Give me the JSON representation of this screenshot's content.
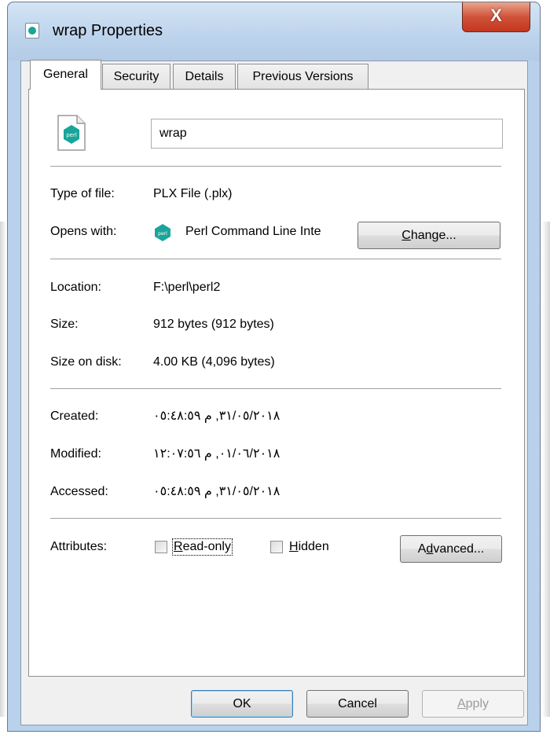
{
  "window": {
    "title": "wrap Properties",
    "close_label": "X"
  },
  "tabs": [
    {
      "label": "General"
    },
    {
      "label": "Security"
    },
    {
      "label": "Details"
    },
    {
      "label": "Previous Versions"
    }
  ],
  "file": {
    "name": "wrap",
    "type_label": "Type of file:",
    "type_value": "PLX File (.plx)",
    "opens_label": "Opens with:",
    "opens_value": "Perl Command Line Inte",
    "change_button": {
      "pre": "",
      "accel": "C",
      "post": "hange..."
    },
    "location_label": "Location:",
    "location_value": "F:\\perl\\perl2",
    "size_label": "Size:",
    "size_value": "912 bytes (912 bytes)",
    "size_disk_label": "Size on disk:",
    "size_disk_value": "4.00 KB (4,096 bytes)",
    "created_label": "Created:",
    "created_value": "٣١/٠٥/٢٠١٨, م ٠٥:٤٨:٥٩",
    "modified_label": "Modified:",
    "modified_value": "٠١/٠٦/٢٠١٨, م ١٢:٠٧:٥٦",
    "accessed_label": "Accessed:",
    "accessed_value": "٣١/٠٥/٢٠١٨, م ٠٥:٤٨:٥٩"
  },
  "attributes": {
    "label": "Attributes:",
    "readonly": {
      "accel": "R",
      "post": "ead-only",
      "checked": false
    },
    "hidden": {
      "accel": "H",
      "post": "idden",
      "checked": false
    },
    "advanced_button": {
      "pre": "A",
      "accel": "d",
      "post": "vanced..."
    }
  },
  "footer": {
    "ok": "OK",
    "cancel": "Cancel",
    "apply": {
      "accel": "A",
      "post": "pply"
    }
  },
  "colors": {
    "accent": "#1aa59a",
    "close": "#c3361e",
    "title_bar": "#bcd3ec"
  },
  "icons": [
    "perl-file-icon",
    "perl-app-icon",
    "close-icon"
  ]
}
